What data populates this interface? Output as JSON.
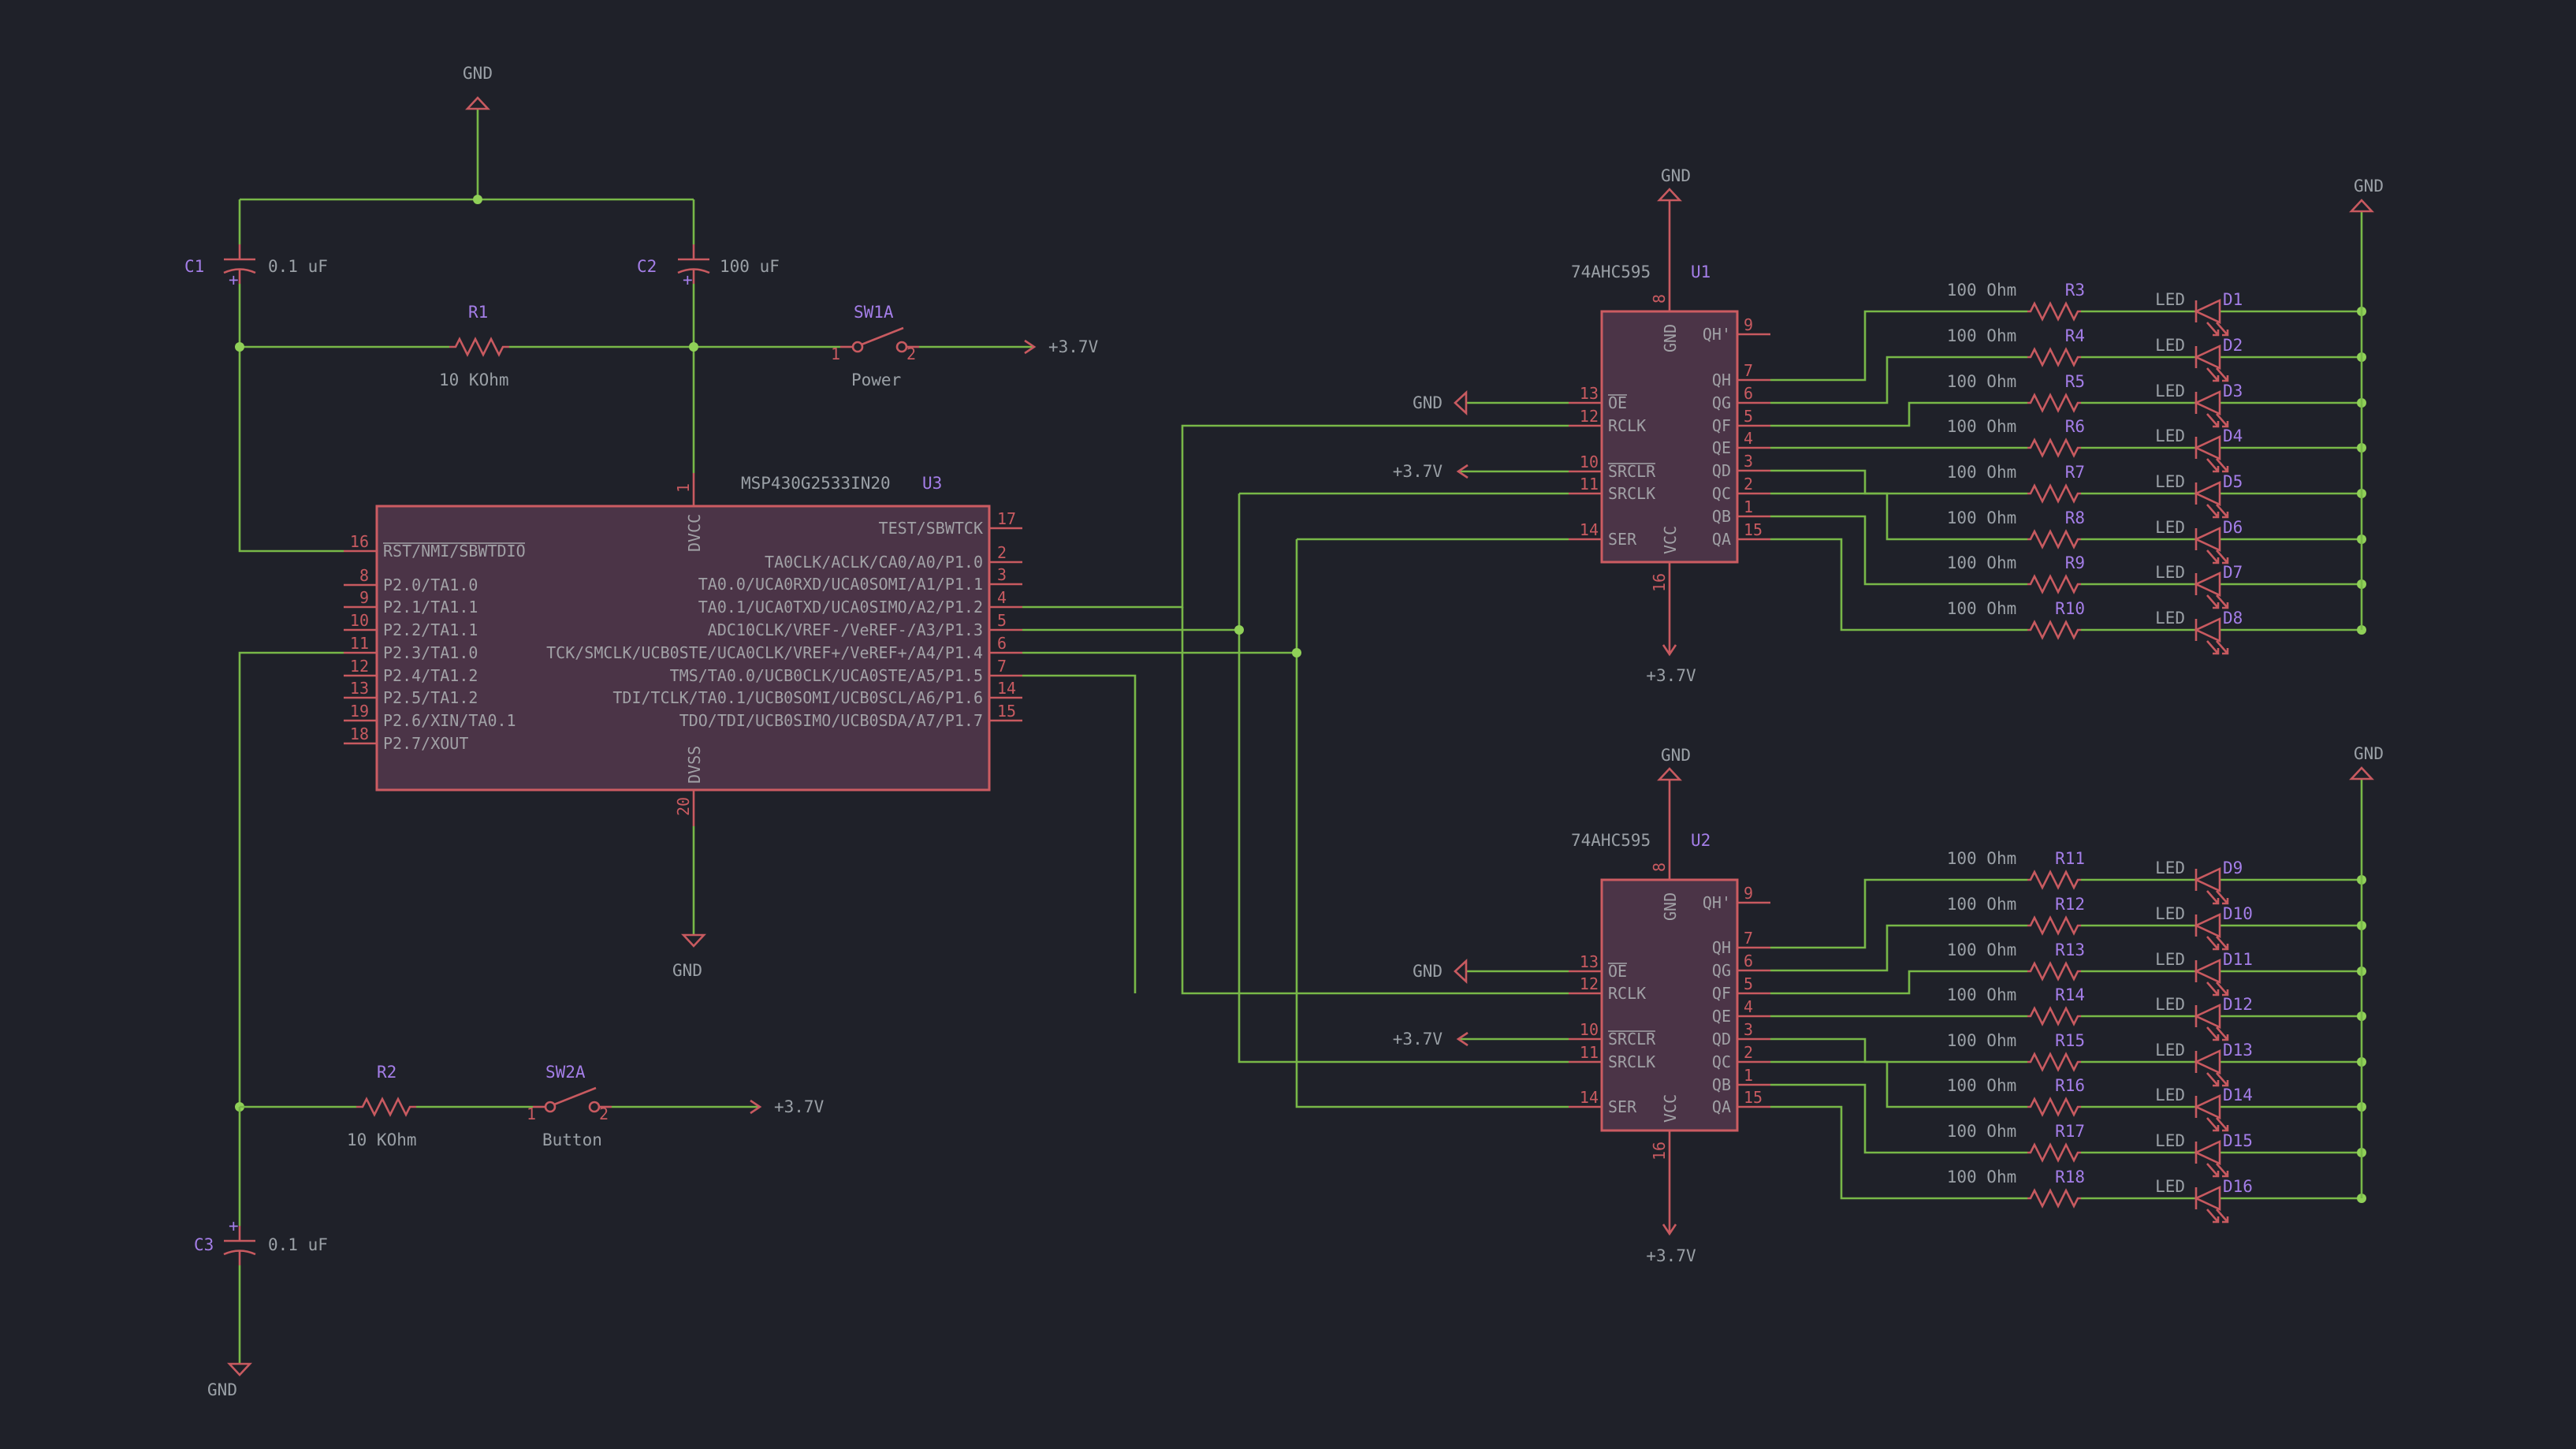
{
  "power": {
    "gnd": "GND",
    "vcc": "+3.7V"
  },
  "mcu": {
    "part": "MSP430G2533IN20",
    "ref": "U3",
    "left_pins": [
      {
        "num": "16",
        "label": "RST/NMI/SBWTDIO"
      },
      {
        "num": "8",
        "label": "P2.0/TA1.0"
      },
      {
        "num": "9",
        "label": "P2.1/TA1.1"
      },
      {
        "num": "10",
        "label": "P2.2/TA1.1"
      },
      {
        "num": "11",
        "label": "P2.3/TA1.0"
      },
      {
        "num": "12",
        "label": "P2.4/TA1.2"
      },
      {
        "num": "13",
        "label": "P2.5/TA1.2"
      },
      {
        "num": "19",
        "label": "P2.6/XIN/TA0.1"
      },
      {
        "num": "18",
        "label": "P2.7/XOUT"
      }
    ],
    "right_pins": [
      {
        "num": "17",
        "label": "TEST/SBWTCK"
      },
      {
        "num": "2",
        "label": "TA0CLK/ACLK/CA0/A0/P1.0"
      },
      {
        "num": "3",
        "label": "TA0.0/UCA0RXD/UCA0SOMI/A1/P1.1"
      },
      {
        "num": "4",
        "label": "TA0.1/UCA0TXD/UCA0SIMO/A2/P1.2"
      },
      {
        "num": "5",
        "label": "ADC10CLK/VREF-/VeREF-/A3/P1.3"
      },
      {
        "num": "6",
        "label": "TCK/SMCLK/UCB0STE/UCA0CLK/VREF+/VeREF+/A4/P1.4"
      },
      {
        "num": "7",
        "label": "TMS/TA0.0/UCB0CLK/UCA0STE/A5/P1.5"
      },
      {
        "num": "14",
        "label": "TDI/TCLK/TA0.1/UCB0SOMI/UCB0SCL/A6/P1.6"
      },
      {
        "num": "15",
        "label": "TDO/TDI/UCB0SIMO/UCB0SDA/A7/P1.7"
      }
    ],
    "top_pin": {
      "num": "1",
      "label": "DVCC"
    },
    "bottom_pin": {
      "num": "20",
      "label": "DVSS"
    }
  },
  "passives": {
    "c1": {
      "ref": "C1",
      "value": "0.1 uF"
    },
    "c2": {
      "ref": "C2",
      "value": "100 uF"
    },
    "c3": {
      "ref": "C3",
      "value": "0.1 uF"
    },
    "r1": {
      "ref": "R1",
      "value": "10 KOhm"
    },
    "r2": {
      "ref": "R2",
      "value": "10 KOhm"
    },
    "sw1": {
      "ref": "SW1A",
      "value": "Power"
    },
    "sw2": {
      "ref": "SW2A",
      "value": "Button"
    },
    "pin_1": "1",
    "pin_2": "2",
    "polarity": "+"
  },
  "shift_registers": [
    {
      "part": "74AHC595",
      "ref": "U1",
      "top_pin": {
        "num": "8",
        "label": "GND"
      },
      "bottom_pin": {
        "num": "16",
        "label": "VCC"
      },
      "left_pins": [
        {
          "num": "13",
          "label": "OE"
        },
        {
          "num": "12",
          "label": "RCLK"
        },
        {
          "num": "10",
          "label": "SRCLR"
        },
        {
          "num": "11",
          "label": "SRCLK"
        },
        {
          "num": "14",
          "label": "SER"
        }
      ],
      "right_pins": [
        {
          "num": "9",
          "label": "QH'"
        },
        {
          "num": "7",
          "label": "QH"
        },
        {
          "num": "6",
          "label": "QG"
        },
        {
          "num": "5",
          "label": "QF"
        },
        {
          "num": "4",
          "label": "QE"
        },
        {
          "num": "3",
          "label": "QD"
        },
        {
          "num": "2",
          "label": "QC"
        },
        {
          "num": "1",
          "label": "QB"
        },
        {
          "num": "15",
          "label": "QA"
        }
      ],
      "resistors": [
        "R3",
        "R4",
        "R5",
        "R6",
        "R7",
        "R8",
        "R9",
        "R10"
      ],
      "leds": [
        "D1",
        "D2",
        "D3",
        "D4",
        "D5",
        "D6",
        "D7",
        "D8"
      ]
    },
    {
      "part": "74AHC595",
      "ref": "U2",
      "top_pin": {
        "num": "8",
        "label": "GND"
      },
      "bottom_pin": {
        "num": "16",
        "label": "VCC"
      },
      "left_pins": [
        {
          "num": "13",
          "label": "OE"
        },
        {
          "num": "12",
          "label": "RCLK"
        },
        {
          "num": "10",
          "label": "SRCLR"
        },
        {
          "num": "11",
          "label": "SRCLK"
        },
        {
          "num": "14",
          "label": "SER"
        }
      ],
      "right_pins": [
        {
          "num": "9",
          "label": "QH'"
        },
        {
          "num": "7",
          "label": "QH"
        },
        {
          "num": "6",
          "label": "QG"
        },
        {
          "num": "5",
          "label": "QF"
        },
        {
          "num": "4",
          "label": "QE"
        },
        {
          "num": "3",
          "label": "QD"
        },
        {
          "num": "2",
          "label": "QC"
        },
        {
          "num": "1",
          "label": "QB"
        },
        {
          "num": "15",
          "label": "QA"
        }
      ],
      "resistors": [
        "R11",
        "R12",
        "R13",
        "R14",
        "R15",
        "R16",
        "R17",
        "R18"
      ],
      "leds": [
        "D9",
        "D10",
        "D11",
        "D12",
        "D13",
        "D14",
        "D15",
        "D16"
      ]
    }
  ],
  "led_value": "LED",
  "resistor_value": "100 Ohm",
  "colors": {
    "background": "#1f2129",
    "wire": "#78b848",
    "symbol": "#c85a60",
    "body_fill": "#4b3447",
    "reference": "#a47ee8",
    "value": "#9aa0a6"
  }
}
